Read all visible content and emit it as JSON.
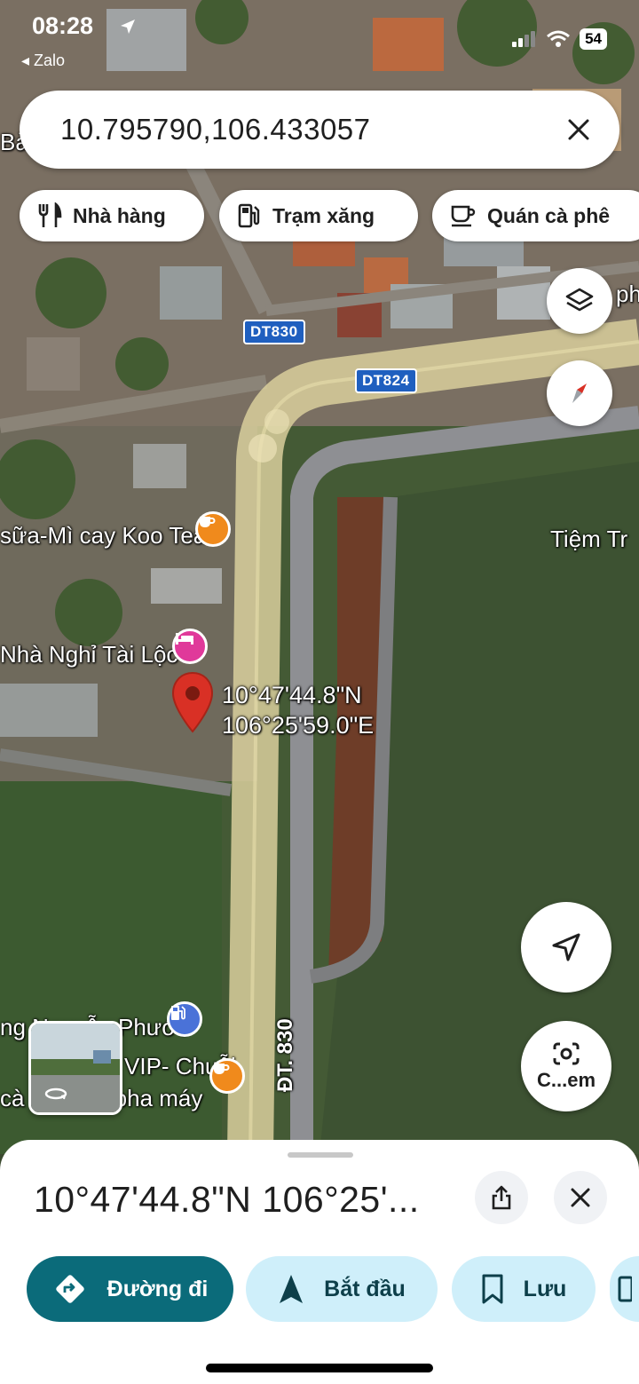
{
  "status_bar": {
    "time": "08:28",
    "back_app": "◂ Zalo",
    "battery": "54"
  },
  "search": {
    "query": "10.795790,106.433057"
  },
  "chips": [
    {
      "label": "Nhà hàng",
      "icon": "fork-knife-icon"
    },
    {
      "label": "Trạm xăng",
      "icon": "gas-station-icon"
    },
    {
      "label": "Quán cà phê",
      "icon": "coffee-cup-icon"
    }
  ],
  "map": {
    "road_labels": [
      "DT830",
      "DT824",
      "ĐT. 830"
    ],
    "place_labels": {
      "koo_tea": "sữa-Mì cay Koo Tea",
      "tiem": "Tiệm Tr",
      "nha_nghi": "Nhà Nghỉ Tài Lộc",
      "nguyen_phuoc": "ng Nguyễn Phước",
      "vip": "VIP- Chuỗi",
      "ca_phe_may": "cà phê đạt pha máy",
      "top_left": "Bà",
      "top_right": "ph"
    },
    "pin_coords": [
      "10°47'44.8\"N",
      "106°25'59.0\"E"
    ],
    "camera_label": "C...em"
  },
  "sheet": {
    "title": "10°47'44.8\"N 106°25'...",
    "actions": [
      {
        "label": "Đường đi",
        "icon": "directions-icon"
      },
      {
        "label": "Bắt đầu",
        "icon": "navigation-arrow-icon"
      },
      {
        "label": "Lưu",
        "icon": "bookmark-icon"
      }
    ]
  },
  "colors": {
    "primary_action": "#0b6b7a",
    "secondary_action": "#cfeffa",
    "pin": "#d93025",
    "road_shield": "#1f5fbf"
  }
}
